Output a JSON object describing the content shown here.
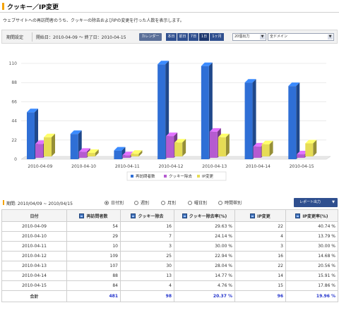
{
  "page": {
    "title": "クッキー／IP変更",
    "description": "ウェブサイトへの再訪問者のうち、クッキーの除去およびIPの変更を行った人数を表示します。"
  },
  "filter": {
    "label": "期間設定",
    "period_text": "開始日：2010-04-09 ～ 終了日：2010-04-15",
    "calendar_label": "カレンダー",
    "ranges": [
      "本日",
      "前日",
      "7日",
      "1日",
      "1ヶ月"
    ],
    "per_page": "20個出力",
    "domain": "全ドメイン"
  },
  "chart_data": {
    "type": "bar",
    "categories": [
      "2010-04-09",
      "2010-04-10",
      "2010-04-11",
      "2010-04-12",
      "2010-04-13",
      "2010-04-14",
      "2010-04-15"
    ],
    "series": [
      {
        "name": "再訪問者数",
        "values": [
          54,
          29,
          10,
          109,
          107,
          88,
          84
        ],
        "color": "#2f6fd6"
      },
      {
        "name": "クッキー除去",
        "values": [
          16,
          7,
          3,
          25,
          30,
          13,
          4
        ],
        "color": "#b55bd0"
      },
      {
        "name": "IP変更",
        "values": [
          22,
          4,
          3,
          16,
          22,
          14,
          15
        ],
        "color": "#e6dc55"
      }
    ],
    "ylim": [
      0,
      110
    ],
    "yticks": [
      0,
      22,
      44,
      66,
      88,
      110
    ],
    "grid": true,
    "legend": "bottom"
  },
  "options": {
    "period_label": "期間: 2010/04/09 ~ 2010/04/15",
    "radios": [
      {
        "label": "日付別",
        "checked": true
      },
      {
        "label": "週別",
        "checked": false
      },
      {
        "label": "月別",
        "checked": false
      },
      {
        "label": "曜日別",
        "checked": false
      },
      {
        "label": "時間帯別",
        "checked": false
      }
    ],
    "report_label": "レポート出力"
  },
  "table": {
    "headers": [
      "日付",
      "再訪問者数",
      "クッキー除去",
      "クッキー除去率(%)",
      "IP変更",
      "IP変更率(%)"
    ],
    "rows": [
      [
        "2010-04-09",
        "54",
        "16",
        "29.63 %",
        "22",
        "40.74 %"
      ],
      [
        "2010-04-10",
        "29",
        "7",
        "24.14 %",
        "4",
        "13.79 %"
      ],
      [
        "2010-04-11",
        "10",
        "3",
        "30.00 %",
        "3",
        "30.00 %"
      ],
      [
        "2010-04-12",
        "109",
        "25",
        "22.94 %",
        "16",
        "14.68 %"
      ],
      [
        "2010-04-13",
        "107",
        "30",
        "28.04 %",
        "22",
        "20.56 %"
      ],
      [
        "2010-04-14",
        "88",
        "13",
        "14.77 %",
        "14",
        "15.91 %"
      ],
      [
        "2010-04-15",
        "84",
        "4",
        "4.76 %",
        "15",
        "17.86 %"
      ]
    ],
    "total": [
      "合計",
      "481",
      "98",
      "20.37 %",
      "96",
      "19.96 %"
    ]
  }
}
